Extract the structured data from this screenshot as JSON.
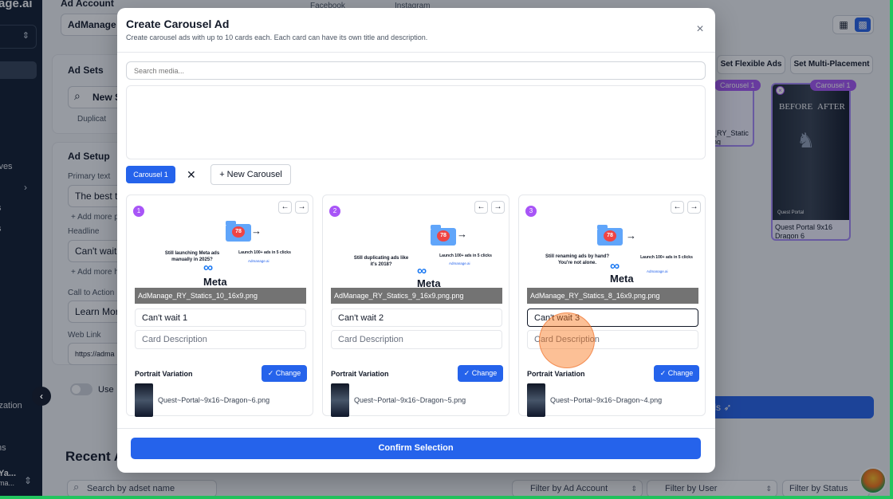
{
  "background": {
    "brand": "age.ai",
    "nav_items": [
      "ives",
      "s",
      "s",
      "ization",
      "ns"
    ],
    "user": {
      "name": "Ya...",
      "sub": "ma..."
    },
    "ad_account": {
      "label": "Ad Account",
      "value": "AdManage L"
    },
    "channels": [
      "Facebook",
      "Instagram"
    ],
    "ad_sets": {
      "title": "Ad Sets",
      "search_value": "New S",
      "duplicate": "Duplicat"
    },
    "ad_setup": {
      "title": "Ad Setup",
      "primary_text_label": "Primary text",
      "primary_text_value": "The best t",
      "add_more_primary": "+ Add more p",
      "headline_label": "Headline",
      "headline_value": "Can't wait",
      "add_more_headline": "+ Add more h",
      "cta_label": "Call to Action",
      "cta_value": "Learn Mor",
      "web_link_label": "Web Link",
      "web_link_value": "https://adma",
      "toggle_label": "Use"
    },
    "set_flexible": "Set Flexible Ads",
    "set_multi": "Set Multi-Placement",
    "tiles": [
      {
        "badge": "Carousel 1",
        "caption": "_RY_Static\nng"
      },
      {
        "badge": "Carousel 1",
        "caption": "Quest Portal 9x16\nDragon 6",
        "img_left": "BEFORE",
        "img_right": "AFTER",
        "img_logo": "Quest Portal"
      }
    ],
    "launch_label": "n Ads",
    "recent_title": "Recent A",
    "filters": {
      "search_placeholder": "Search by adset name",
      "ad_account": "Filter by Ad Account",
      "user": "Filter by User",
      "status": "Filter by Status"
    }
  },
  "modal": {
    "title": "Create Carousel Ad",
    "subtitle": "Create carousel ads with up to 10 cards each. Each card can have its own title and description.",
    "search_placeholder": "Search media...",
    "active_tab": "Carousel 1",
    "new_carousel": "+ New Carousel",
    "confirm": "Confirm Selection",
    "portrait_label": "Portrait Variation",
    "change_label": "Change",
    "desc_placeholder": "Card Description",
    "cards": [
      {
        "num": "1",
        "file": "AdManage_RY_Statics_10_16x9.png",
        "title_value": "Can't wait 1",
        "portrait_file": "Quest~Portal~9x16~Dragon~6.png",
        "preview_left": "Still launching Meta ads manually in 2025?",
        "preview_right": "Launch 100+ ads in 5 clicks",
        "badge": "78"
      },
      {
        "num": "2",
        "file": "AdManage_RY_Statics_9_16x9.png.png",
        "title_value": "Can't wait 2",
        "portrait_file": "Quest~Portal~9x16~Dragon~5.png",
        "preview_left": "Still duplicating ads like it's 2018?",
        "preview_right": "Launch 100+ ads in 5 clicks",
        "badge": "78"
      },
      {
        "num": "3",
        "file": "AdManage_RY_Statics_8_16x9.png.png",
        "title_value": "Can't wait 3",
        "portrait_file": "Quest~Portal~9x16~Dragon~4.png",
        "preview_left": "Still renaming ads by hand? You're not alone.",
        "preview_right": "Launch 100+ ads in 5 clicks",
        "badge": "78"
      }
    ],
    "preview_brand": "Admanage.ai",
    "meta_word": "Meta"
  },
  "colors": {
    "primary": "#2563eb",
    "badge_purple": "#a855f7",
    "sidebar": "#0f1b2d"
  }
}
